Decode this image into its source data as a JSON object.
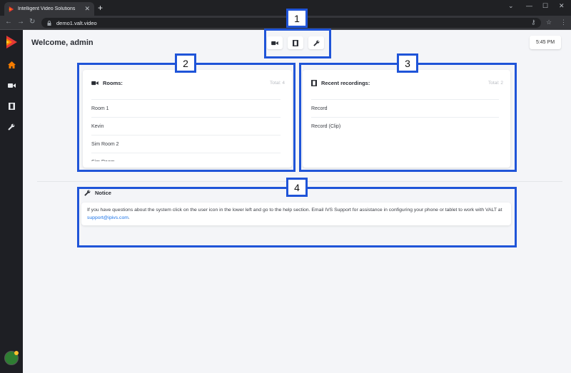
{
  "browser": {
    "tab_title": "Intelligent Video Solutions",
    "tab_close": "✕",
    "new_tab": "+",
    "url": "demo1.valt.video",
    "window_controls": [
      "⌄",
      "—",
      "☐",
      "✕"
    ]
  },
  "header": {
    "welcome": "Welcome, admin",
    "time": "5:45 PM"
  },
  "quick_actions": [
    "video-camera-icon",
    "film-icon",
    "wrench-icon"
  ],
  "sidebar": {
    "items": [
      "home-icon",
      "video-camera-icon",
      "film-icon",
      "wrench-icon"
    ]
  },
  "rooms": {
    "title": "Rooms:",
    "total": "Total: 4",
    "items": [
      "Room 1",
      "Kevin",
      "Sim Room 2",
      "Sim Room"
    ]
  },
  "recordings": {
    "title": "Recent recordings:",
    "total": "Total: 2",
    "items": [
      "Record",
      "Record (Clip)"
    ]
  },
  "notice": {
    "title": "Notice",
    "text": "If you have questions about the system click on the user icon in the lower left and go to the help section. Email IVS Support for assistance in configuring your phone or tablet to work with VALT at ",
    "link": "support@ipivs.com",
    "end": "."
  },
  "annotations": [
    "1",
    "2",
    "3",
    "4"
  ],
  "colors": {
    "accent": "#f57c00",
    "annotation": "#1f54d8",
    "sidebar": "#1e1f24",
    "background": "#f4f5f8"
  }
}
